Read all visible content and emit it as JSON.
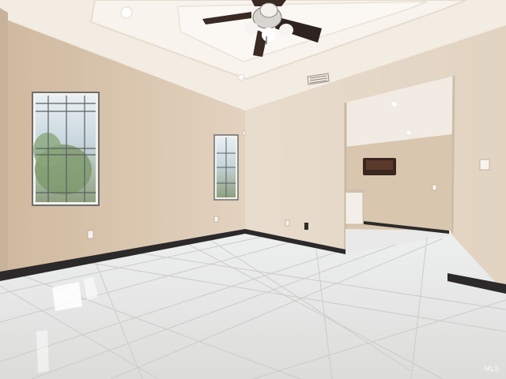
{
  "photo": {
    "subject": "empty-room-interior",
    "colors": {
      "wall_left": "#dcc9b1",
      "wall_right": "#e6d7c5",
      "ceiling": "#f4ede4",
      "floor": "#e4e4e2",
      "baseboard": "#2c2a2a",
      "fan_blade": "#3a2a24",
      "window_glass": "#b7c9d3"
    }
  },
  "watermark": {
    "text": "MLS"
  }
}
